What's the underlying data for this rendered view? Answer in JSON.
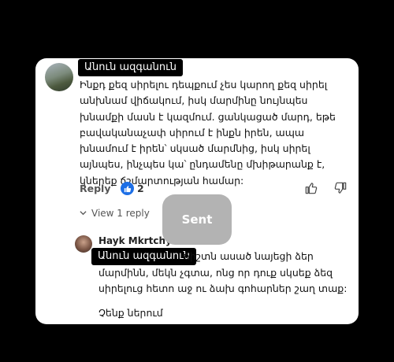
{
  "comment": {
    "author_tag": "Անուն ազգանուն",
    "text": "Ինքդ քեզ սիրելու դեպքում չես կարող քեզ սիրել անխնամ վիճակում, իսկ մարմինը նույնպես խնամքի մասն է կազմում. ցանկացած մարդ, եթե բավականաչափ սիրում է ինքն իրեն, ապա խնամում է իրեն՝ սկսած մարմնից, իսկ սիրել այնպես, ինչպես կա՝ ընդամենը մխիթարանք է, կներեք ճշմարտության համար:",
    "reply_label": "Reply",
    "like_count": "2",
    "view_replies_label": "View 1 reply"
  },
  "reply": {
    "author_name": "Hayk Mkrtchya",
    "author_tag": "Անուն ազգանուն",
    "text": "ճիշտն ասած նայեցի ձեր մարմինն, մեկն չգտա, ոնց որ դուք սկսեք ձեզ սիրելուց հետո աջ ու ձախ գոհարներ շաղ տաք:",
    "signature": "Չենք ներում"
  },
  "toast": {
    "label": "Sent"
  },
  "colors": {
    "like_blue": "#1d6fe6",
    "toast_bg": "#b3b3b3"
  }
}
